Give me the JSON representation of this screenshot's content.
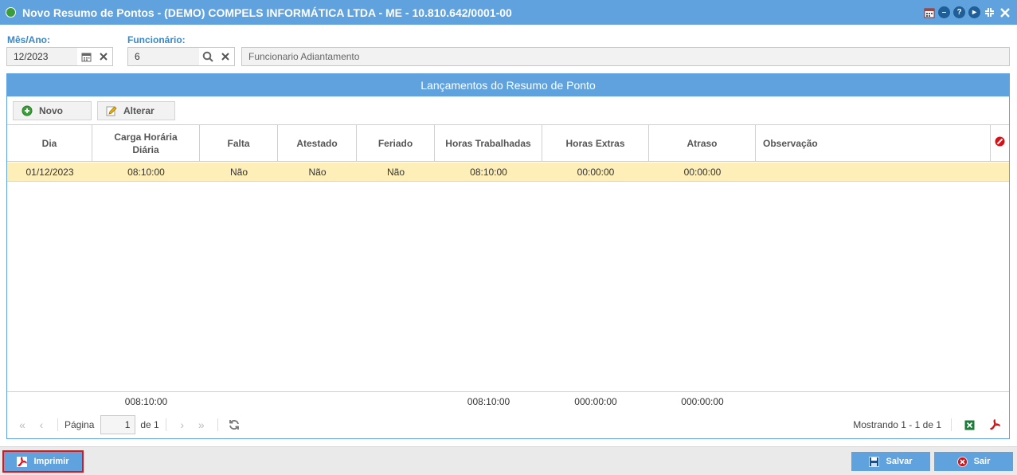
{
  "window": {
    "title": "Novo Resumo de Pontos - (DEMO) COMPELS INFORMÁTICA LTDA - ME - 10.810.642/0001-00"
  },
  "form": {
    "mes_ano_label": "Mês/Ano:",
    "mes_ano_value": "12/2023",
    "funcionario_label": "Funcionário:",
    "funcionario_id": "6",
    "funcionario_nome": "Funcionario Adiantamento"
  },
  "panel": {
    "title": "Lançamentos do Resumo de Ponto",
    "toolbar": {
      "novo": "Novo",
      "alterar": "Alterar"
    }
  },
  "grid": {
    "columns": [
      "Dia",
      "Carga Horária Diária",
      "Falta",
      "Atestado",
      "Feriado",
      "Horas Trabalhadas",
      "Horas Extras",
      "Atraso",
      "Observação"
    ],
    "rows": [
      {
        "dia": "01/12/2023",
        "carga": "08:10:00",
        "falta": "Não",
        "atestado": "Não",
        "feriado": "Não",
        "trabalhadas": "08:10:00",
        "extras": "00:00:00",
        "atraso": "00:00:00",
        "obs": ""
      }
    ],
    "summary": {
      "carga": "008:10:00",
      "trabalhadas": "008:10:00",
      "extras": "000:00:00",
      "atraso": "000:00:00"
    }
  },
  "pager": {
    "page_label": "Página",
    "page_value": "1",
    "of_label": "de 1",
    "showing": "Mostrando 1 - 1 de 1"
  },
  "footer": {
    "imprimir": "Imprimir",
    "salvar": "Salvar",
    "sair": "Sair"
  },
  "colors": {
    "header_blue": "#5fa2dd",
    "selected_row": "#fdefb7",
    "highlight_red": "#e0141a"
  }
}
